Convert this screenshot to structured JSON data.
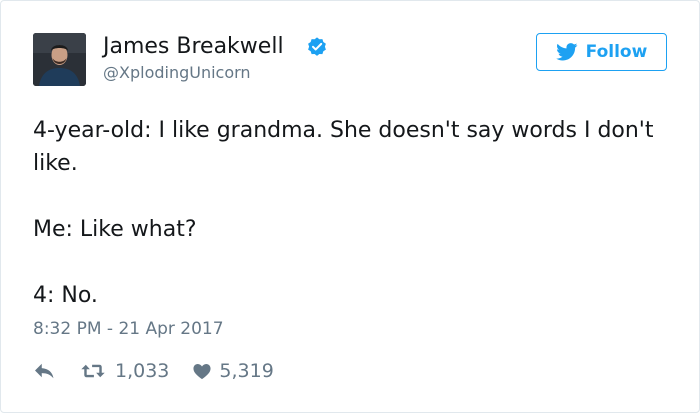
{
  "user": {
    "display_name": "James Breakwell",
    "screen_name": "@XplodingUnicorn",
    "verified": true,
    "avatar_icon": "user-photo"
  },
  "follow_button": {
    "label": "Follow",
    "icon": "twitter-bird-icon"
  },
  "tweet": {
    "paragraphs": [
      "4-year-old: I like grandma. She doesn't say words I don't like.",
      "Me: Like what?",
      "4: No."
    ],
    "timestamp": "8:32 PM - 21 Apr 2017"
  },
  "actions": {
    "reply_icon": "reply-icon",
    "retweet_icon": "retweet-icon",
    "retweet_count": "1,033",
    "like_icon": "heart-icon",
    "like_count": "5,319"
  },
  "colors": {
    "brand": "#1da1f2",
    "text": "#14171a",
    "muted": "#657786",
    "border": "#e1e8ed"
  }
}
